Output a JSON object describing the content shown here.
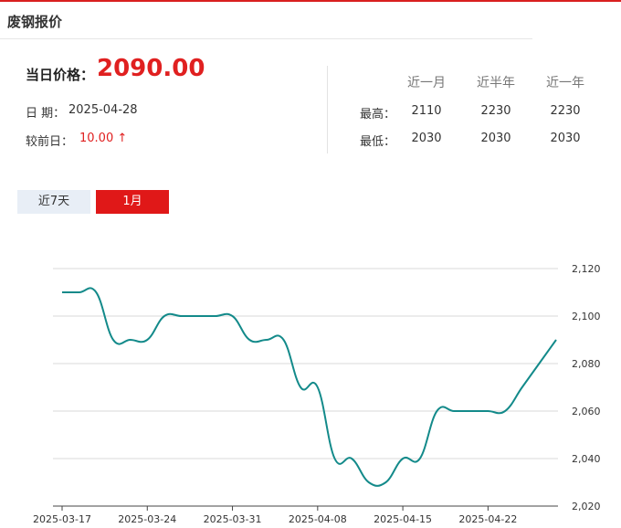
{
  "header": {
    "title": "废钢报价"
  },
  "today": {
    "price_label": "当日价格：",
    "price_value": "2090.00",
    "date_label": "日  期：",
    "date_value": "2025-04-28",
    "change_label": "较前日：",
    "change_value": "10.00 ↑"
  },
  "stats": {
    "columns": [
      "近一月",
      "近半年",
      "近一年"
    ],
    "rows": [
      {
        "label": "最高：",
        "values": [
          "2110",
          "2230",
          "2230"
        ]
      },
      {
        "label": "最低：",
        "values": [
          "2030",
          "2030",
          "2030"
        ]
      }
    ]
  },
  "tabs": [
    {
      "label": "近7天",
      "active": false
    },
    {
      "label": "1月",
      "active": true
    }
  ],
  "colors": {
    "accent": "#e01818",
    "line": "#138a8a",
    "tab_inactive": "#e8eef6"
  },
  "chart_data": {
    "type": "line",
    "x": [
      "2025-03-17",
      "2025-03-18",
      "2025-03-19",
      "2025-03-20",
      "2025-03-21",
      "2025-03-24",
      "2025-03-25",
      "2025-03-26",
      "2025-03-27",
      "2025-03-28",
      "2025-03-31",
      "2025-04-01",
      "2025-04-02",
      "2025-04-03",
      "2025-04-07",
      "2025-04-08",
      "2025-04-09",
      "2025-04-10",
      "2025-04-11",
      "2025-04-14",
      "2025-04-15",
      "2025-04-16",
      "2025-04-17",
      "2025-04-18",
      "2025-04-21",
      "2025-04-22",
      "2025-04-23",
      "2025-04-24",
      "2025-04-25",
      "2025-04-28"
    ],
    "y": [
      2110,
      2110,
      2110,
      2090,
      2090,
      2090,
      2100,
      2100,
      2100,
      2100,
      2100,
      2090,
      2090,
      2090,
      2070,
      2070,
      2040,
      2040,
      2030,
      2030,
      2040,
      2040,
      2060,
      2060,
      2060,
      2060,
      2060,
      2070,
      2080,
      2090
    ],
    "x_ticks": [
      "2025-03-17",
      "2025-03-24",
      "2025-03-31",
      "2025-04-08",
      "2025-04-15",
      "2025-04-22"
    ],
    "y_ticks": [
      "2,020",
      "2,040",
      "2,060",
      "2,080",
      "2,100",
      "2,120"
    ],
    "ylim": [
      2020,
      2120
    ],
    "grid": true
  }
}
